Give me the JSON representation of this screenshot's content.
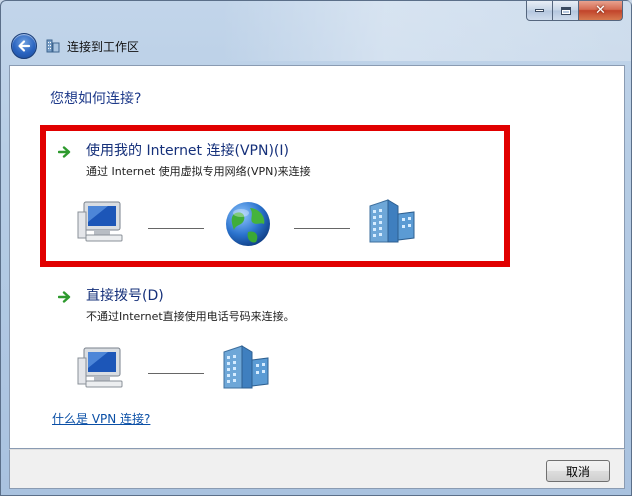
{
  "window": {
    "title": "连接到工作区"
  },
  "heading": "您想如何连接?",
  "options": [
    {
      "title": "使用我的 Internet 连接(VPN)(I)",
      "description": "通过 Internet 使用虚拟专用网络(VPN)来连接"
    },
    {
      "title": "直接拨号(D)",
      "description": "不通过Internet直接使用电话号码来连接。"
    }
  ],
  "help_link": "什么是 VPN 连接?",
  "footer": {
    "cancel_label": "取消"
  },
  "icons": {
    "back": "back-arrow-icon",
    "wizard": "workplace-network-icon",
    "option_arrow": "green-arrow-icon",
    "computer": "computer-icon",
    "globe": "globe-icon",
    "building": "office-building-icon",
    "minimize": "minimize-icon",
    "maximize": "maximize-icon",
    "close": "close-icon"
  },
  "colors": {
    "highlight": "#e10000",
    "heading_blue": "#1e3a8a",
    "link_blue": "#0a4fa6"
  }
}
